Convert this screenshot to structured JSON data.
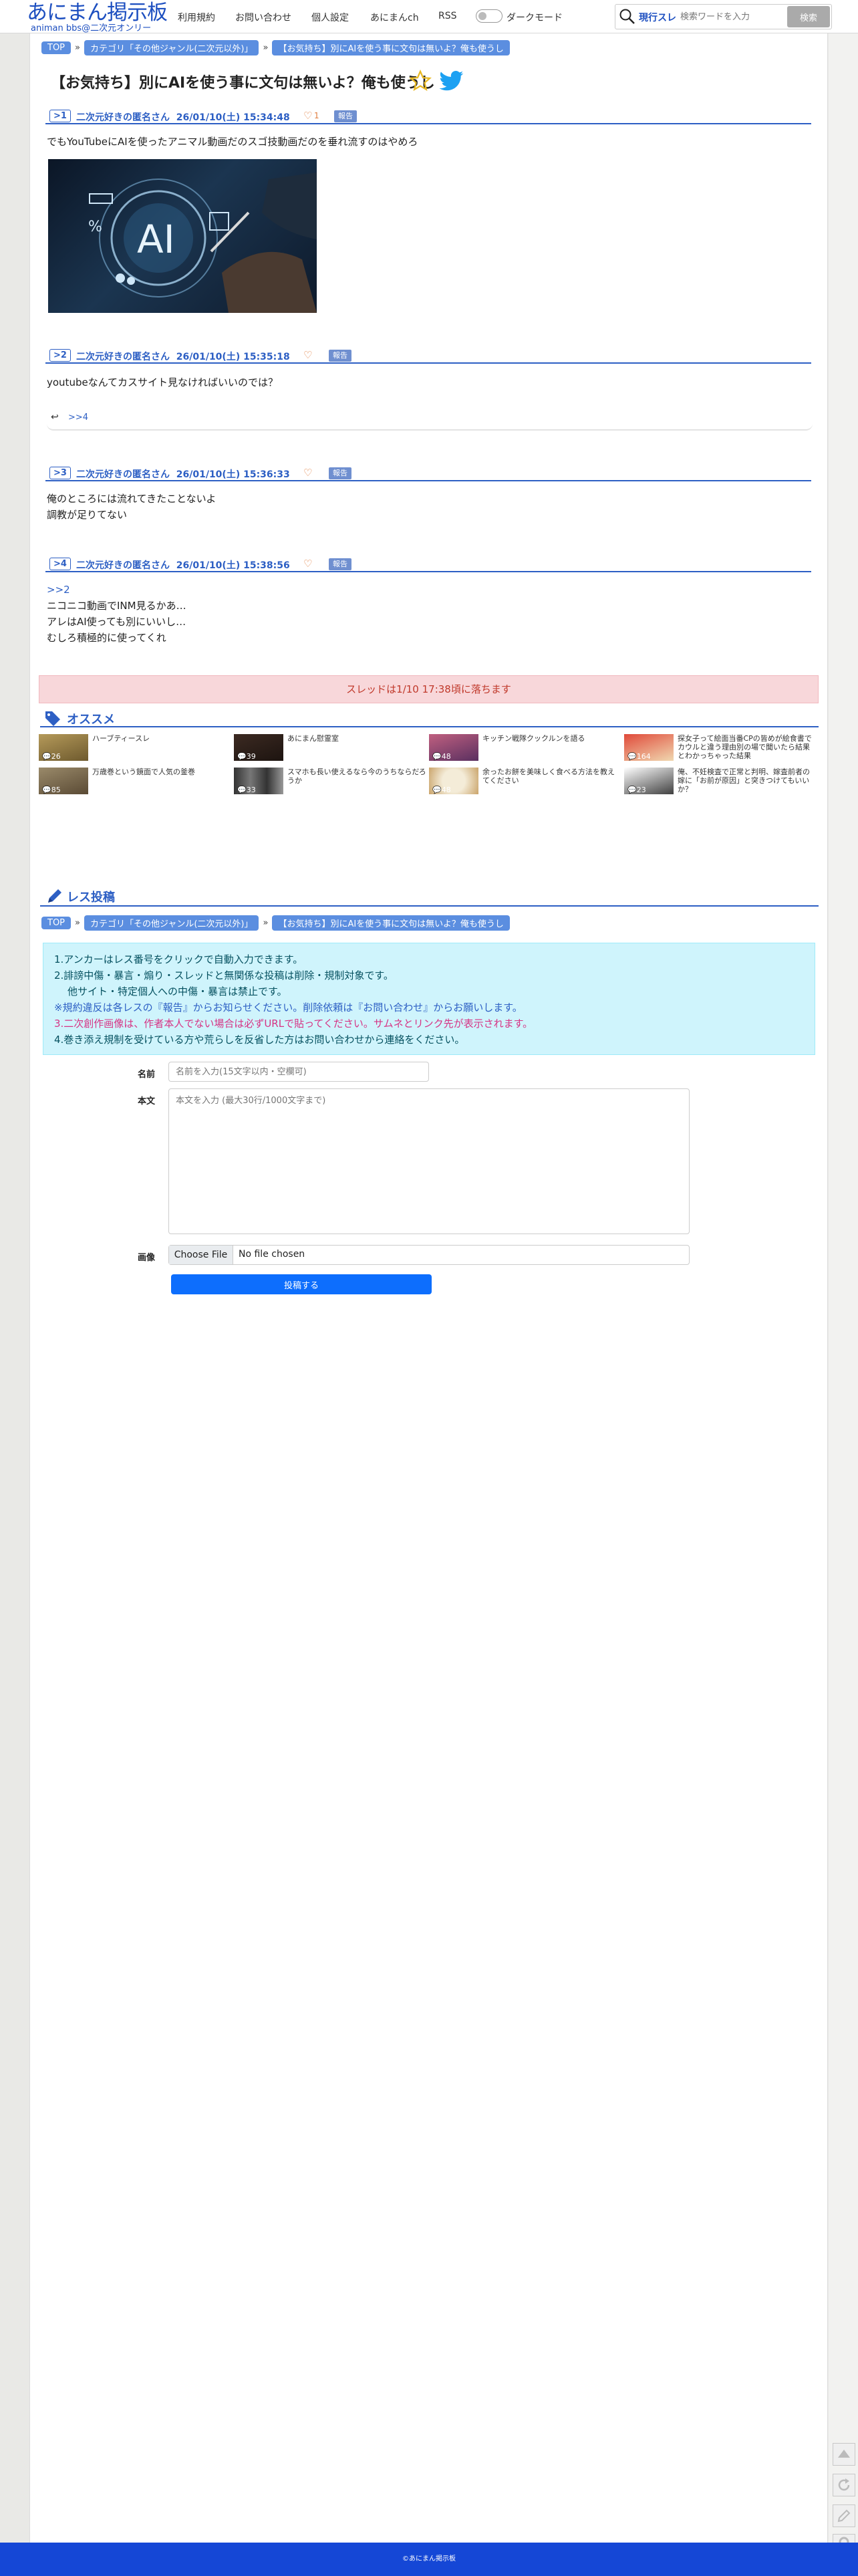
{
  "header": {
    "logo_main": "あにまん掲示板",
    "logo_sub": "animan bbs@二次元オンリー",
    "nav": [
      "利用規約",
      "お問い合わせ",
      "個人設定",
      "あにまんch",
      "RSS"
    ],
    "dark_mode_label": "ダークモード",
    "search_scope": "現行スレ",
    "search_placeholder": "検索ワードを入力",
    "search_button": "検索"
  },
  "breadcrumb": {
    "top": "TOP",
    "category": "カテゴリ「その他ジャンル(二次元以外)」",
    "thread": "【お気持ち】別にAIを使う事に文句は無いよ？俺も使うし"
  },
  "thread": {
    "title": "【お気持ち】別にAIを使う事に文句は無いよ？俺も使うし",
    "report_label": "報告",
    "posts": [
      {
        "num": ">1",
        "name": "二次元好きの匿名さん",
        "date": "26/01/10(土) 15:34:48",
        "likes": "1",
        "lines": [
          "でもYouTubeにAIを使ったアニマル動画だのスゴ技動画だのを垂れ流すのはやめろ"
        ]
      },
      {
        "num": ">2",
        "name": "二次元好きの匿名さん",
        "date": "26/01/10(土) 15:35:18",
        "likes": "",
        "lines": [
          "youtubeなんてカスサイト見なければいいのでは？"
        ],
        "reply_anchor": ">>4"
      },
      {
        "num": ">3",
        "name": "二次元好きの匿名さん",
        "date": "26/01/10(土) 15:36:33",
        "likes": "",
        "lines": [
          "俺のところには流れてきたことないよ",
          "調教が足りてない"
        ]
      },
      {
        "num": ">4",
        "name": "二次元好きの匿名さん",
        "date": "26/01/10(土) 15:38:56",
        "likes": "",
        "anchor": ">>2",
        "lines": [
          "ニコニコ動画でINM見るかあ…",
          "アレはAI使っても別にいいし…",
          "むしろ積極的に使ってくれ"
        ]
      }
    ],
    "expire_notice": "スレッドは1/10 17:38頃に落ちます"
  },
  "recommend": {
    "heading": "オススメ",
    "items": [
      {
        "title": "ハーブティースレ",
        "count": "26"
      },
      {
        "title": "あにまん慰霊室",
        "count": "39"
      },
      {
        "title": "キッチン戦隊クックルンを語る",
        "count": "48"
      },
      {
        "title": "探女子って絵面当番CPの皆めが絵食書でカウルと違う理由別の場で聞いたら結果とわかっちゃった結果",
        "count": "164"
      },
      {
        "title": "万歳巻という鏡面で人気の釜巻",
        "count": "85"
      },
      {
        "title": "スマホも長い使えるなら今のうちならだろうか",
        "count": "33"
      },
      {
        "title": "余ったお餅を美味しく食べる方法を教えてください",
        "count": "48"
      },
      {
        "title": "俺、不妊検査で正常と判明、嫁査前者の嫁に「お前が原因」と突きつけてもいいか？",
        "count": "23"
      }
    ]
  },
  "reply_form": {
    "heading": "レス投稿",
    "rules": [
      "1.アンカーはレス番号をクリックで自動入力できます。",
      "2.誹謗中傷・暴言・煽り・スレッドと無関係な投稿は削除・規制対象です。",
      "他サイト・特定個人への中傷・暴言は禁止です。",
      "※規約違反は各レスの『報告』からお知らせください。削除依頼は『お問い合わせ』からお願いします。",
      "3.二次創作画像は、作者本人でない場合は必ずURLで貼ってください。サムネとリンク先が表示されます。",
      "4.巻き添え規制を受けている方や荒らしを反省した方はお問い合わせから連絡をください。"
    ],
    "name_label": "名前",
    "name_placeholder": "名前を入力(15文字以内・空欄可)",
    "body_label": "本文",
    "body_placeholder": "本文を入力 (最大30行/1000文字まで)",
    "image_label": "画像",
    "file_button": "Choose File",
    "file_status": "No file chosen",
    "submit": "投稿する"
  },
  "footer": {
    "copyright": "©あにまん掲示板"
  },
  "colors": {
    "brand": "#1d4fc0",
    "accent": "#2d5fc4",
    "footer": "#1547d6",
    "alert_bg": "#f8d7da",
    "info_bg": "#cff4fc"
  }
}
